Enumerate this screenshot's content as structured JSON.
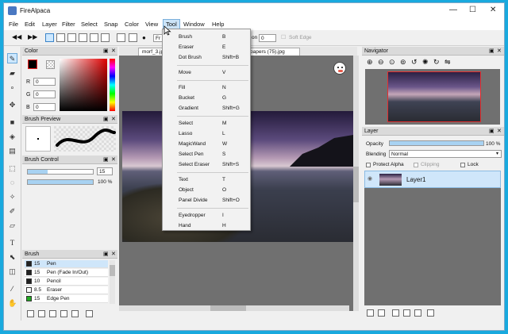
{
  "app": {
    "title": "FireAlpaca"
  },
  "window_controls": {
    "minimize": "—",
    "maximize": "☐",
    "close": "✕"
  },
  "menu": [
    {
      "label": "File"
    },
    {
      "label": "Edit"
    },
    {
      "label": "Layer"
    },
    {
      "label": "Filter"
    },
    {
      "label": "Select"
    },
    {
      "label": "Snap"
    },
    {
      "label": "Color"
    },
    {
      "label": "View"
    },
    {
      "label": "Tool"
    },
    {
      "label": "Window"
    },
    {
      "label": "Help"
    }
  ],
  "toolbar": {
    "partial_dropdown": "Fr",
    "position_label": "on",
    "position_value": "0",
    "soft_edge_label": "Soft Edge"
  },
  "tool_menu": [
    {
      "label": "Brush",
      "shortcut": "B"
    },
    {
      "label": "Eraser",
      "shortcut": "E"
    },
    {
      "label": "Dot Brush",
      "shortcut": "Shift+B"
    },
    {
      "label": "Move",
      "shortcut": "V"
    },
    {
      "label": "Fill",
      "shortcut": "N"
    },
    {
      "label": "Bucket",
      "shortcut": "G"
    },
    {
      "label": "Gradient",
      "shortcut": "Shift+G"
    },
    {
      "label": "Select",
      "shortcut": "M"
    },
    {
      "label": "Lasso",
      "shortcut": "L"
    },
    {
      "label": "MagicWand",
      "shortcut": "W"
    },
    {
      "label": "Select Pen",
      "shortcut": "S"
    },
    {
      "label": "Select Eraser",
      "shortcut": "Shift+S"
    },
    {
      "label": "Text",
      "shortcut": "T"
    },
    {
      "label": "Object",
      "shortcut": "O"
    },
    {
      "label": "Panel Divide",
      "shortcut": "Shift+O"
    },
    {
      "label": "Eyedropper",
      "shortcut": "I"
    },
    {
      "label": "Hand",
      "shortcut": "H"
    }
  ],
  "canvas_tabs": [
    {
      "label": "morf_3.jp"
    },
    {
      "label": "papers (75).jpg"
    }
  ],
  "color_panel": {
    "title": "Color",
    "r_label": "R",
    "g_label": "G",
    "b_label": "B",
    "r": "0",
    "g": "0",
    "b": "0"
  },
  "brush_preview": {
    "title": "Brush Preview"
  },
  "brush_control": {
    "title": "Brush Control",
    "size": "15",
    "opacity": "100 %",
    "opacity_fraction": 1.0
  },
  "brush_list": {
    "title": "Brush",
    "items": [
      {
        "size": "15",
        "name": "Pen",
        "color": "#222222"
      },
      {
        "size": "15",
        "name": "Pen (Fade In/Out)",
        "color": "#222222"
      },
      {
        "size": "10",
        "name": "Pencil",
        "color": "#222222"
      },
      {
        "size": "8.5",
        "name": "Eraser",
        "color": "#ffffff"
      },
      {
        "size": "15",
        "name": "Edge Pen",
        "color": "#22aa22"
      }
    ]
  },
  "navigator": {
    "title": "Navigator"
  },
  "layer_panel": {
    "title": "Layer",
    "opacity_label": "Opacity",
    "opacity_value": "100 %",
    "opacity_fraction": 1.0,
    "blending_label": "Blending",
    "blending_value": "Normal",
    "protect_alpha": "Protect Alpha",
    "clipping": "Clipping",
    "lock": "Lock",
    "layers": [
      {
        "name": "Layer1"
      }
    ]
  },
  "colors": {
    "accent": "#cfe6fa",
    "nav_frame": "#e23030",
    "desktop": "#19a9de"
  }
}
